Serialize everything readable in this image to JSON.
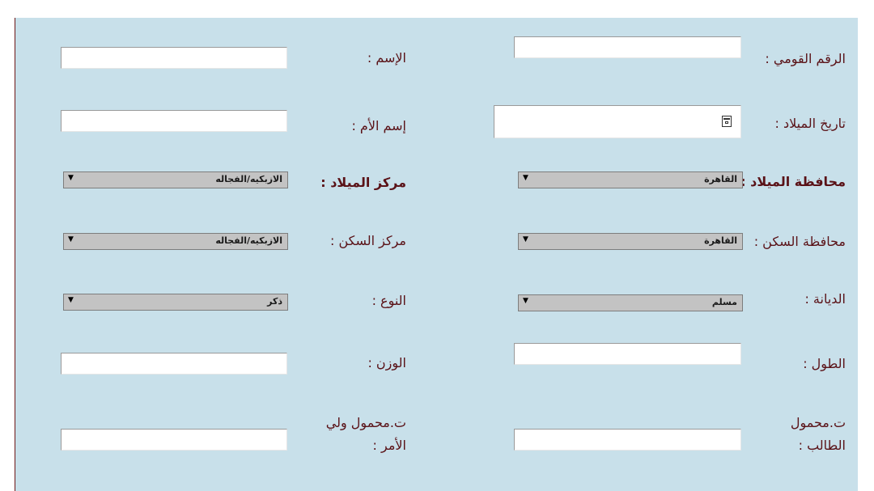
{
  "form": {
    "national_id": {
      "label": "الرقم القومي :",
      "value": ""
    },
    "name": {
      "label": "الإسم :",
      "value": ""
    },
    "birth_date": {
      "label": "تاريخ الميلاد :",
      "value": ""
    },
    "mother_name": {
      "label": "إسم الأم :",
      "value": ""
    },
    "birth_governorate": {
      "label": "محافظة الميلاد :",
      "value": "القاهرة"
    },
    "birth_center": {
      "label": "مركز الميلاد :",
      "value": "الازبكيه/الفجاله"
    },
    "residence_governorate": {
      "label": "محافظة السكن :",
      "value": "القاهرة"
    },
    "residence_center": {
      "label": "مركز السكن :",
      "value": "الازبكيه/الفجاله"
    },
    "religion": {
      "label": "الديانة :",
      "value": "مسلم"
    },
    "gender": {
      "label": "النوع :",
      "value": "ذكر"
    },
    "height": {
      "label": "الطول :",
      "value": ""
    },
    "weight": {
      "label": "الوزن :",
      "value": ""
    },
    "student_mobile": {
      "label": "ت.محمول الطالب :",
      "value": ""
    },
    "guardian_mobile": {
      "label": "ت.محمول ولي الأمر :",
      "value": ""
    }
  },
  "icons": {
    "calendar": "calendar-icon",
    "dropdown": "dropdown-arrow-icon"
  },
  "colors": {
    "panel": "#c8e0ea",
    "label": "#5a1217",
    "select": "#c3c3c3",
    "left_border": "#6d1818"
  }
}
